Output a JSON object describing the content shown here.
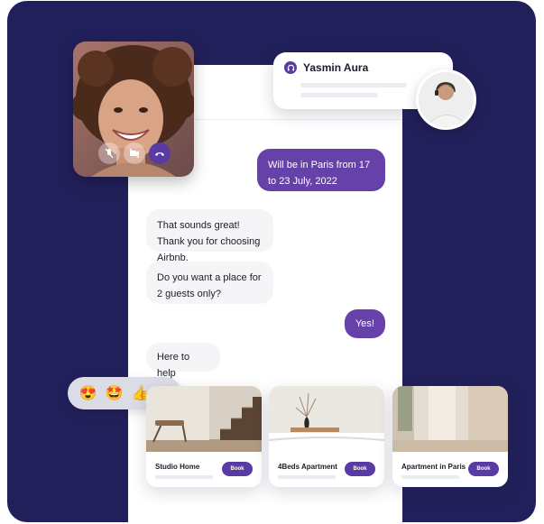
{
  "colors": {
    "background_panel": "#22205a",
    "accent": "#6541a9",
    "incoming_bubble": "#f5f5f8"
  },
  "video_call": {
    "controls": [
      {
        "icon": "mic-off-icon"
      },
      {
        "icon": "video-off-icon"
      },
      {
        "icon": "end-call-icon"
      }
    ]
  },
  "contact": {
    "name": "Yasmin Aura",
    "icon": "headset-icon"
  },
  "messages": [
    {
      "direction": "outgoing",
      "text": "Will be in Paris from 17 to 23 July, 2022"
    },
    {
      "direction": "incoming",
      "text": "That sounds great! Thank you for choosing Airbnb."
    },
    {
      "direction": "incoming",
      "text": "Do you want a place for 2 guests only?"
    },
    {
      "direction": "outgoing",
      "text": "Yes!"
    },
    {
      "direction": "incoming",
      "text": "Here to help"
    }
  ],
  "reactions": [
    "😍",
    "🤩",
    "👍",
    "🙌"
  ],
  "listings": [
    {
      "title": "Studio Home",
      "button": "Book"
    },
    {
      "title": "4Beds Apartment",
      "button": "Book"
    },
    {
      "title": "Apartment in Paris",
      "button": "Book"
    }
  ]
}
